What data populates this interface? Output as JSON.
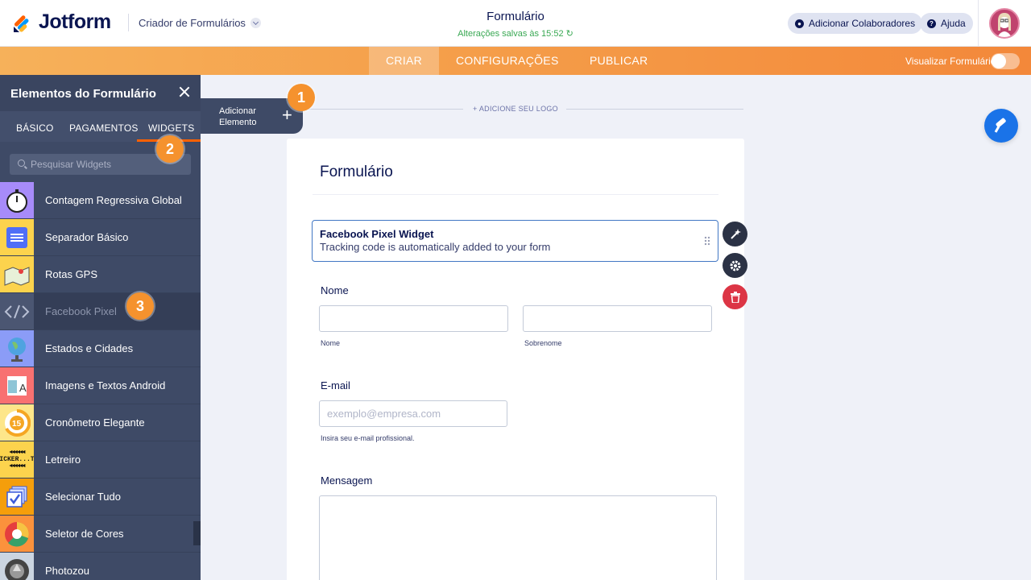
{
  "header": {
    "brand": "Jotform",
    "builder_label": "Criador de Formulários",
    "form_title": "Formulário",
    "saved_status": "Alterações salvas às 15:52",
    "add_collaborators": "Adicionar Colaboradores",
    "help": "Ajuda"
  },
  "nav": {
    "tabs": [
      "CRIAR",
      "CONFIGURAÇÕES",
      "PUBLICAR"
    ],
    "active_tab": "CRIAR",
    "preview_label": "Visualizar Formulário",
    "preview_enabled": false
  },
  "sidebar": {
    "title": "Elementos do Formulário",
    "tabs": [
      "BÁSICO",
      "PAGAMENTOS",
      "WIDGETS"
    ],
    "active_tab": "WIDGETS",
    "search_placeholder": "Pesquisar Widgets",
    "widgets": [
      {
        "label": "Contagem Regressiva Global",
        "icon": "stopwatch-icon",
        "color": "#a78bfa"
      },
      {
        "label": "Separador Básico",
        "icon": "separator-icon",
        "color": "#fcd34d"
      },
      {
        "label": "Rotas GPS",
        "icon": "map-icon",
        "color": "#fcd34d"
      },
      {
        "label": "Facebook Pixel",
        "icon": "code-icon",
        "color": "#4b5672"
      },
      {
        "label": "Estados e Cidades",
        "icon": "globe-icon",
        "color": "#8b9cf7"
      },
      {
        "label": "Imagens e Textos Android",
        "icon": "image-text-icon",
        "color": "#f87171"
      },
      {
        "label": "Cronômetro Elegante",
        "icon": "timer-15-icon",
        "color": "#fde68a"
      },
      {
        "label": "Letreiro",
        "icon": "ticker-icon",
        "color": "#fcd34d"
      },
      {
        "label": "Selecionar Tudo",
        "icon": "checkbox-stack-icon",
        "color": "#f59e0b"
      },
      {
        "label": "Seletor de Cores",
        "icon": "color-wheel-icon",
        "color": "#fb923c"
      },
      {
        "label": "Photozou",
        "icon": "camera-shutter-icon",
        "color": "#cbd5e1"
      }
    ],
    "ticker_text": "TICKER...TI"
  },
  "canvas": {
    "add_element_label": "Adicionar Elemento",
    "add_logo_label": "+ ADICIONE SEU LOGO",
    "form_heading": "Formulário",
    "fb_widget_title": "Facebook Pixel Widget",
    "fb_widget_subtitle": "Tracking code is automatically added to your form",
    "name_label": "Nome",
    "first_name_sublabel": "Nome",
    "last_name_sublabel": "Sobrenome",
    "email_label": "E-mail",
    "email_placeholder": "exemplo@empresa.com",
    "email_sublabel": "Insira seu e-mail profissional.",
    "message_label": "Mensagem"
  },
  "badges": [
    "1",
    "2",
    "3"
  ],
  "colors": {
    "accent_orange": "#f5922e",
    "sidebar_bg": "#3e4a66",
    "selection_blue": "#4277c4",
    "delete_red": "#dc3545",
    "fab_blue": "#1a73e8"
  }
}
